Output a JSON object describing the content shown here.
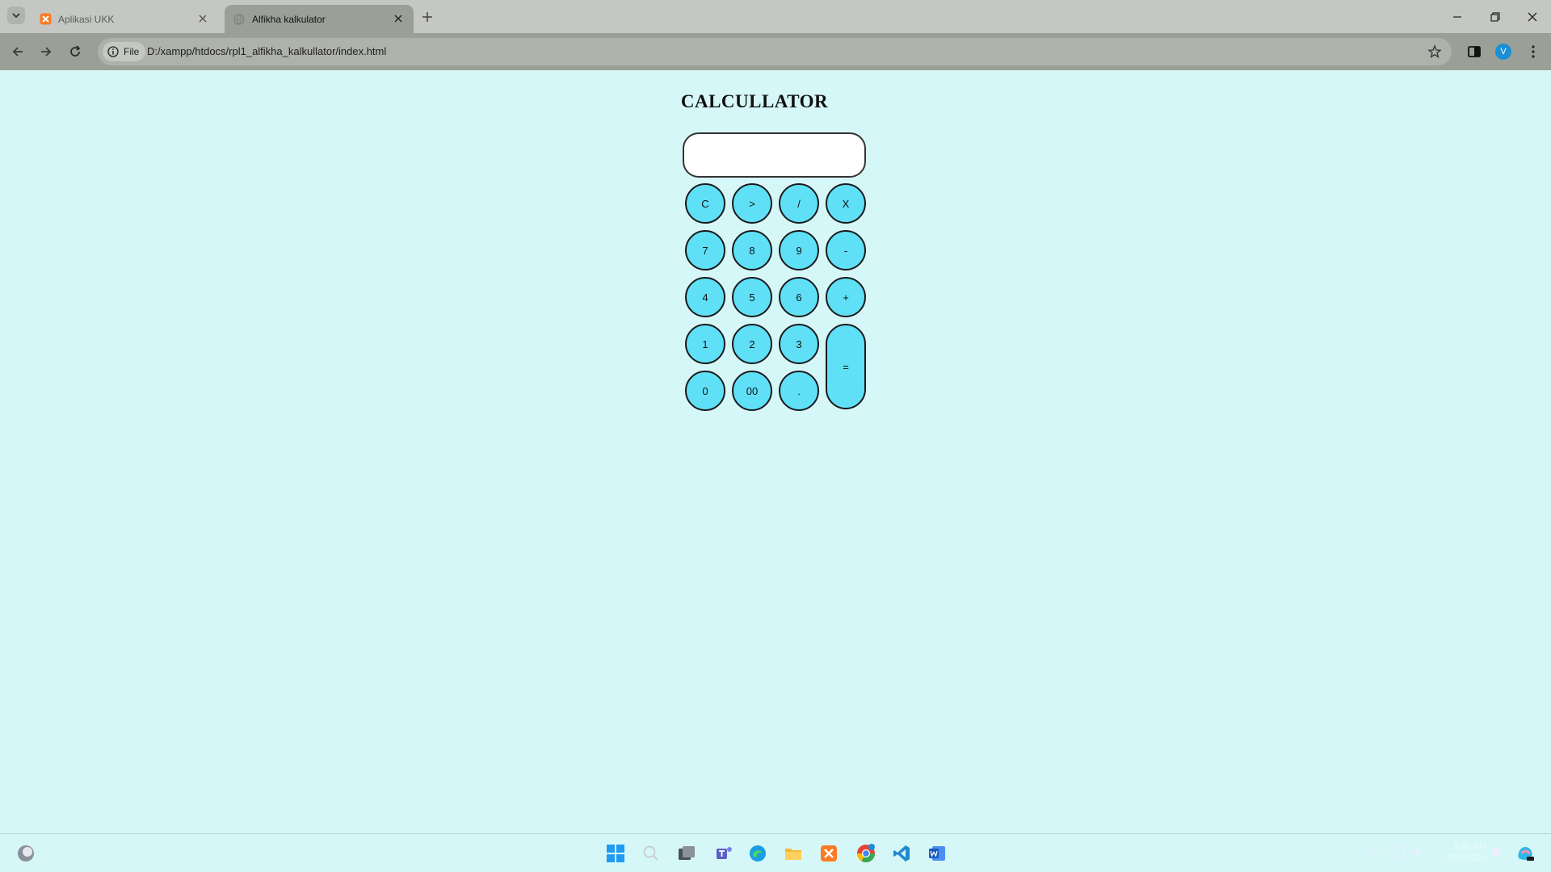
{
  "browser": {
    "tabs": [
      {
        "title": "Aplikasi UKK"
      },
      {
        "title": "Alfikha kalkulator"
      }
    ],
    "address": {
      "chip_label": "File",
      "url": "D:/xampp/htdocs/rpl1_alfikha_kalkullator/index.html"
    },
    "profile_initial": "V"
  },
  "page": {
    "title": "CALCULLATOR",
    "display_value": ""
  },
  "keys": {
    "clear": "C",
    "back": ">",
    "divide": "/",
    "multiply": "X",
    "seven": "7",
    "eight": "8",
    "nine": "9",
    "minus": "-",
    "four": "4",
    "five": "5",
    "six": "6",
    "plus": "+",
    "one": "1",
    "two": "2",
    "three": "3",
    "equals": "=",
    "zero": "0",
    "double_zero": "00",
    "dot": "."
  },
  "taskbar": {
    "clock_time": "8:40 AM",
    "clock_date": "3/26/2024",
    "apps": [
      "windows-start",
      "search",
      "task-view",
      "teams",
      "edge",
      "file-explorer",
      "xampp",
      "chrome",
      "vscode",
      "word"
    ]
  },
  "colors": {
    "page_background": "#d6f7f7",
    "key_fill": "#5fe0f6",
    "key_border": "#1a1a1a",
    "tab_bar": "#c5c7c3",
    "toolbar": "#9aa097"
  }
}
